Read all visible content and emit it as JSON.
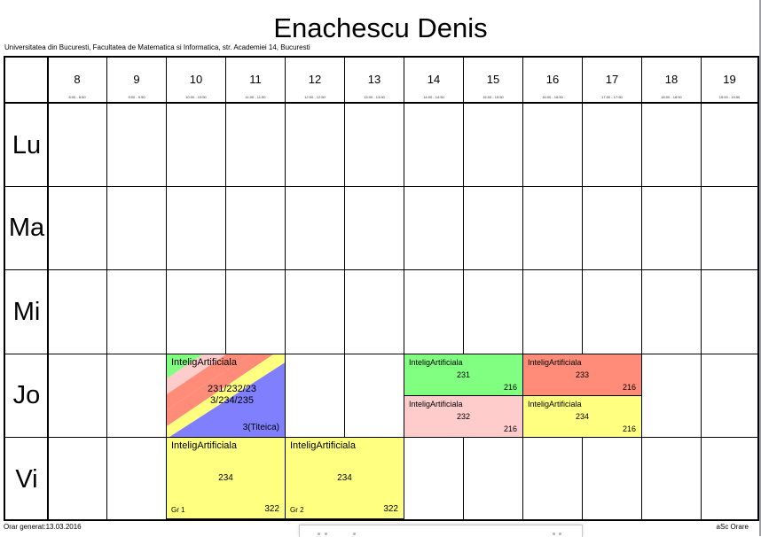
{
  "title": "Enachescu Denis",
  "subtitle": "Universitatea din Bucuresti, Facultatea de Matematica si Informatica, str. Academiei 14, Bucuresti",
  "hours": [
    "8",
    "9",
    "10",
    "11",
    "12",
    "13",
    "14",
    "15",
    "16",
    "17",
    "18",
    "19"
  ],
  "hour_ranges": [
    "8:00 - 8:50",
    "9:00 - 9:50",
    "10:00 - 10:50",
    "11:00 - 11:50",
    "12:00 - 12:50",
    "13:00 - 13:50",
    "14:00 - 14:50",
    "15:00 - 15:50",
    "16:00 - 16:50",
    "17:00 - 17:50",
    "18:00 - 18:50",
    "19:00 - 19:50"
  ],
  "days": [
    "Lu",
    "Ma",
    "Mi",
    "Jo",
    "Vi"
  ],
  "colors": {
    "green": "#80ff80",
    "pink": "#ffcccc",
    "salmon": "#ff8c78",
    "yellow": "#ffff80",
    "blue": "#8080ff"
  },
  "lessons": {
    "jo_10": {
      "subject": "InteligArtificiala",
      "groups": "231/232/233/234/235",
      "room": "3(Titeica)"
    },
    "jo_14_a": {
      "subject": "InteligArtificiala",
      "groups": "231",
      "room": "216"
    },
    "jo_14_b": {
      "subject": "InteligArtificiala",
      "groups": "232",
      "room": "216"
    },
    "jo_16_a": {
      "subject": "InteligArtificiala",
      "groups": "233",
      "room": "216"
    },
    "jo_16_b": {
      "subject": "InteligArtificiala",
      "groups": "234",
      "room": "216"
    },
    "vi_10": {
      "subject": "InteligArtificiala",
      "groups": "234",
      "room": "322",
      "subgroup": "Gr 1"
    },
    "vi_12": {
      "subject": "InteligArtificiala",
      "groups": "234",
      "room": "322",
      "subgroup": "Gr 2"
    }
  },
  "footer": {
    "generated": "Orar generat:13.03.2016",
    "app": "aSc Orare"
  }
}
